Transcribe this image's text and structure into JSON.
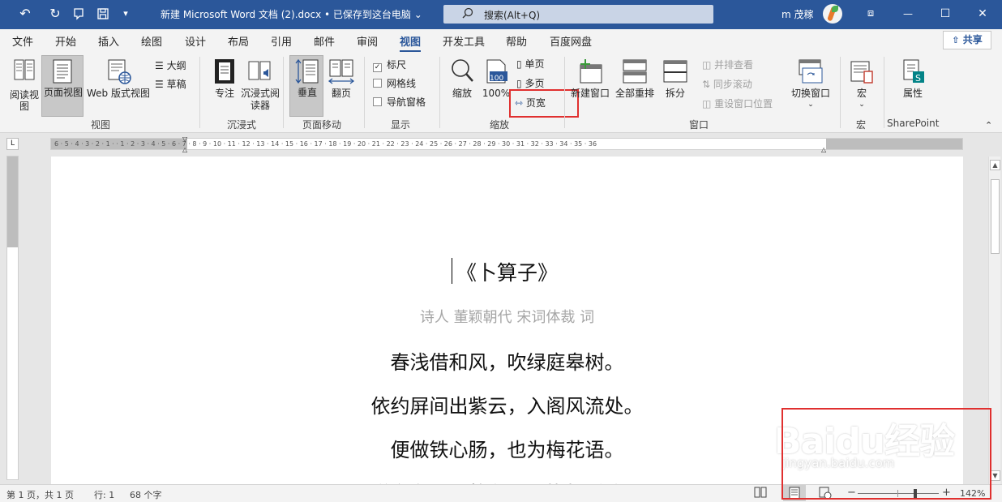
{
  "titlebar": {
    "doc_title": "新建 Microsoft Word 文档 (2).docx • 已保存到这台电脑 ⌄",
    "search_placeholder": "搜索(Alt+Q)",
    "user": "m 茂稼",
    "quick_access": {
      "undo": "↶",
      "redo": "↻",
      "save": "🖫",
      "more": "▾"
    },
    "window_buttons": {
      "ribbon_display": "⧈",
      "minimize": "—",
      "restore": "☐",
      "close": "✕"
    }
  },
  "tabs": [
    "文件",
    "开始",
    "插入",
    "绘图",
    "设计",
    "布局",
    "引用",
    "邮件",
    "审阅",
    "视图",
    "开发工具",
    "帮助",
    "百度网盘"
  ],
  "active_tab": "视图",
  "share_label": "共享",
  "ribbon": {
    "views": {
      "read_mode": "阅读视图",
      "print_layout": "页面视图",
      "web_layout": "Web 版式视图",
      "outline": "大纲",
      "draft": "草稿",
      "label": "视图"
    },
    "immersive": {
      "focus": "专注",
      "immersive_reader": "沉浸式阅读器",
      "label": "沉浸式"
    },
    "page_movement": {
      "vertical": "垂直",
      "side_to_side": "翻页",
      "label": "页面移动"
    },
    "show": {
      "ruler": "标尺",
      "gridlines": "网格线",
      "navigation_pane": "导航窗格",
      "label": "显示",
      "ruler_checked": true
    },
    "zoom": {
      "zoom": "缩放",
      "hundred": "100%",
      "hundred_icon": "100",
      "one_page": "单页",
      "multiple_pages": "多页",
      "page_width": "页宽",
      "label": "缩放"
    },
    "window": {
      "new_window": "新建窗口",
      "arrange_all": "全部重排",
      "split": "拆分",
      "side_by_side": "并排查看",
      "sync_scrolling": "同步滚动",
      "reset_position": "重设窗口位置",
      "switch_windows": "切换窗口",
      "label": "窗口"
    },
    "macros": {
      "macros": "宏",
      "label": "宏"
    },
    "sharepoint": {
      "properties": "属性",
      "label": "SharePoint"
    }
  },
  "ruler": {
    "horizontal": "6 · 5 · 4 · 3 · 2 · 1 · · 1 · 2 · 3 · 4 · 5 · 6 · 7 · 8 · 9 · 10 · 11 · 12 · 13 · 14 · 15 · 16 · 17 · 18 · 19 · 20 · 21 · 22 · 23 · 24 · 25 · 26 · 27 · 28 · 29 · 30 · 31 · 32 · 33 · 34 · 35 · 36",
    "corner": "L"
  },
  "document": {
    "title": "《卜算子》",
    "meta": "诗人  董颖朝代  宋词体裁  词",
    "lines": [
      "春浅借和风，吹绿庭皋树。",
      "依约屏间出紫云，入阁风流处。",
      "便做铁心肠，也为梅花语。",
      "说向东君更将留，环拢相看路。"
    ]
  },
  "status": {
    "page": "第 1 页，共 1 页",
    "line": "行: 1",
    "chars": "68 个字",
    "zoom_minus": "−",
    "zoom_plus": "+",
    "zoom": "142%",
    "zoom_level": 0.71
  },
  "watermark": {
    "big": "Baidu经验",
    "small": "jingyan.baidu.com"
  },
  "colors": {
    "titlebar": "#2b579a",
    "highlight_box": "#e0302f",
    "ribbon": "#f3f3f3",
    "meta_text": "#a6a6a6"
  }
}
